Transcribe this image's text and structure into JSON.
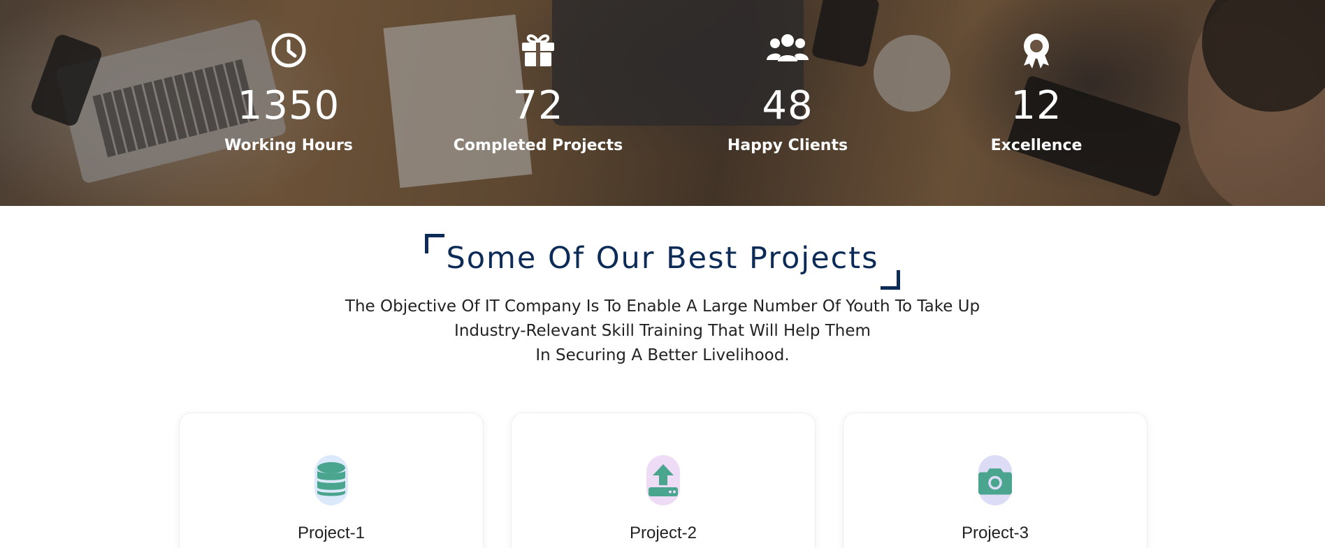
{
  "stats": [
    {
      "icon": "clock-icon",
      "number": "1350",
      "label": "Working Hours"
    },
    {
      "icon": "gift-icon",
      "number": "72",
      "label": "Completed Projects"
    },
    {
      "icon": "users-icon",
      "number": "48",
      "label": "Happy Clients"
    },
    {
      "icon": "award-icon",
      "number": "12",
      "label": "Excellence"
    }
  ],
  "projects_section": {
    "title": "Some Of Our Best Projects",
    "description_lines": [
      "The Objective Of IT Company Is To Enable A Large Number Of Youth To Take Up",
      "Industry-Relevant Skill Training That Will Help Them",
      "In Securing A Better Livelihood."
    ],
    "cards": [
      {
        "icon": "database-icon",
        "title": "Project-1",
        "badge_color": "#dbe9fb"
      },
      {
        "icon": "upload-drive-icon",
        "title": "Project-2",
        "badge_color": "#eedcf7"
      },
      {
        "icon": "camera-icon",
        "title": "Project-3",
        "badge_color": "#dcdcf7"
      }
    ]
  },
  "colors": {
    "heading": "#0d2b57",
    "icon_teal": "#4aa58f",
    "stat_text": "#ffffff"
  }
}
